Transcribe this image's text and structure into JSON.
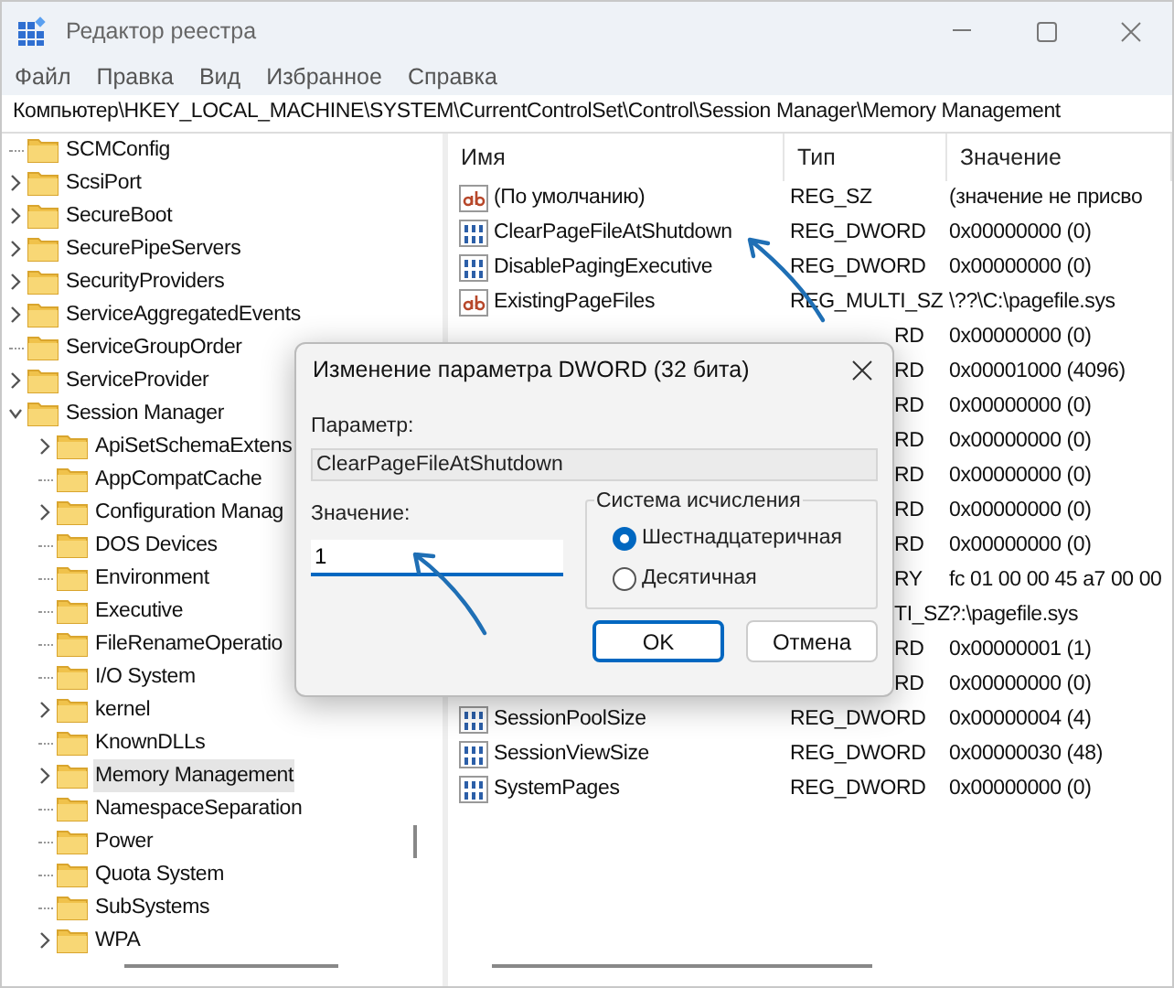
{
  "window": {
    "title": "Редактор реестра"
  },
  "menu": [
    "Файл",
    "Правка",
    "Вид",
    "Избранное",
    "Справка"
  ],
  "address": "Компьютер\\HKEY_LOCAL_MACHINE\\SYSTEM\\CurrentControlSet\\Control\\Session Manager\\Memory Management",
  "tree": [
    {
      "label": "SCMConfig",
      "selected": false
    },
    {
      "label": "ScsiPort",
      "expanded": false,
      "selected": false
    },
    {
      "label": "SecureBoot",
      "expanded": false,
      "selected": false
    },
    {
      "label": "SecurePipeServers",
      "expanded": false,
      "selected": false
    },
    {
      "label": "SecurityProviders",
      "expanded": false,
      "selected": false
    },
    {
      "label": "ServiceAggregatedEvents",
      "expanded": false,
      "selected": false
    },
    {
      "label": "ServiceGroupOrder",
      "selected": false
    },
    {
      "label": "ServiceProvider",
      "expanded": false,
      "selected": false
    },
    {
      "label": "Session Manager",
      "expanded": true,
      "selected": false,
      "children": [
        {
          "label": "ApiSetSchemaExtens",
          "expanded": false,
          "selected": false
        },
        {
          "label": "AppCompatCache",
          "selected": false
        },
        {
          "label": "Configuration Manag",
          "expanded": false,
          "selected": false
        },
        {
          "label": "DOS Devices",
          "selected": false
        },
        {
          "label": "Environment",
          "selected": false
        },
        {
          "label": "Executive",
          "selected": false
        },
        {
          "label": "FileRenameOperatio",
          "selected": false
        },
        {
          "label": "I/O System",
          "selected": false
        },
        {
          "label": "kernel",
          "expanded": false,
          "selected": false
        },
        {
          "label": "KnownDLLs",
          "selected": false
        },
        {
          "label": "Memory Management",
          "expanded": false,
          "selected": true
        },
        {
          "label": "NamespaceSeparation",
          "selected": false
        },
        {
          "label": "Power",
          "selected": false
        },
        {
          "label": "Quota System",
          "selected": false
        },
        {
          "label": "SubSystems",
          "selected": false
        },
        {
          "label": "WPA",
          "expanded": false,
          "selected": false
        }
      ]
    }
  ],
  "table": {
    "columns": [
      "Имя",
      "Тип",
      "Значение"
    ],
    "rows": [
      {
        "kind": "string",
        "name": "(По умолчанию)",
        "type": "REG_SZ",
        "value": "(значение не присво"
      },
      {
        "kind": "dword",
        "name": "ClearPageFileAtShutdown",
        "type": "REG_DWORD",
        "value": "0x00000000 (0)"
      },
      {
        "kind": "dword",
        "name": "DisablePagingExecutive",
        "type": "REG_DWORD",
        "value": "0x00000000 (0)"
      },
      {
        "kind": "string",
        "name": "ExistingPageFiles",
        "type": "REG_MULTI_SZ",
        "value": "\\??\\C:\\pagefile.sys"
      },
      {
        "kind": "covered",
        "type": "RD",
        "value": "0x00000000 (0)"
      },
      {
        "kind": "covered",
        "type": "RD",
        "value": "0x00001000 (4096)"
      },
      {
        "kind": "covered",
        "type": "RD",
        "value": "0x00000000 (0)"
      },
      {
        "kind": "covered",
        "type": "RD",
        "value": "0x00000000 (0)"
      },
      {
        "kind": "covered",
        "type": "RD",
        "value": "0x00000000 (0)"
      },
      {
        "kind": "covered",
        "type": "RD",
        "value": "0x00000000 (0)"
      },
      {
        "kind": "covered",
        "type": "RD",
        "value": "0x00000000 (0)"
      },
      {
        "kind": "covered",
        "type": "RY",
        "value": "fc 01 00 00 45 a7 00 00"
      },
      {
        "kind": "covered",
        "type": "TI_SZ",
        "value": "?:\\pagefile.sys"
      },
      {
        "kind": "covered",
        "type": "RD",
        "value": "0x00000001 (1)"
      },
      {
        "kind": "covered",
        "type": "RD",
        "value": "0x00000000 (0)"
      },
      {
        "kind": "dword",
        "name": "SessionPoolSize",
        "type": "REG_DWORD",
        "value": "0x00000004 (4)"
      },
      {
        "kind": "dword",
        "name": "SessionViewSize",
        "type": "REG_DWORD",
        "value": "0x00000030 (48)"
      },
      {
        "kind": "dword",
        "name": "SystemPages",
        "type": "REG_DWORD",
        "value": "0x00000000 (0)"
      }
    ]
  },
  "dialog": {
    "title": "Изменение параметра DWORD (32 бита)",
    "param_label": "Параметр:",
    "param_value": "ClearPageFileAtShutdown",
    "value_label": "Значение:",
    "value": "1",
    "base_group": "Система исчисления",
    "bases": [
      {
        "label": "Шестнадцатеричная",
        "selected": true
      },
      {
        "label": "Десятичная",
        "selected": false
      }
    ],
    "buttons": [
      {
        "label": "OK",
        "default": true
      },
      {
        "label": "Отмена",
        "default": false
      }
    ]
  }
}
